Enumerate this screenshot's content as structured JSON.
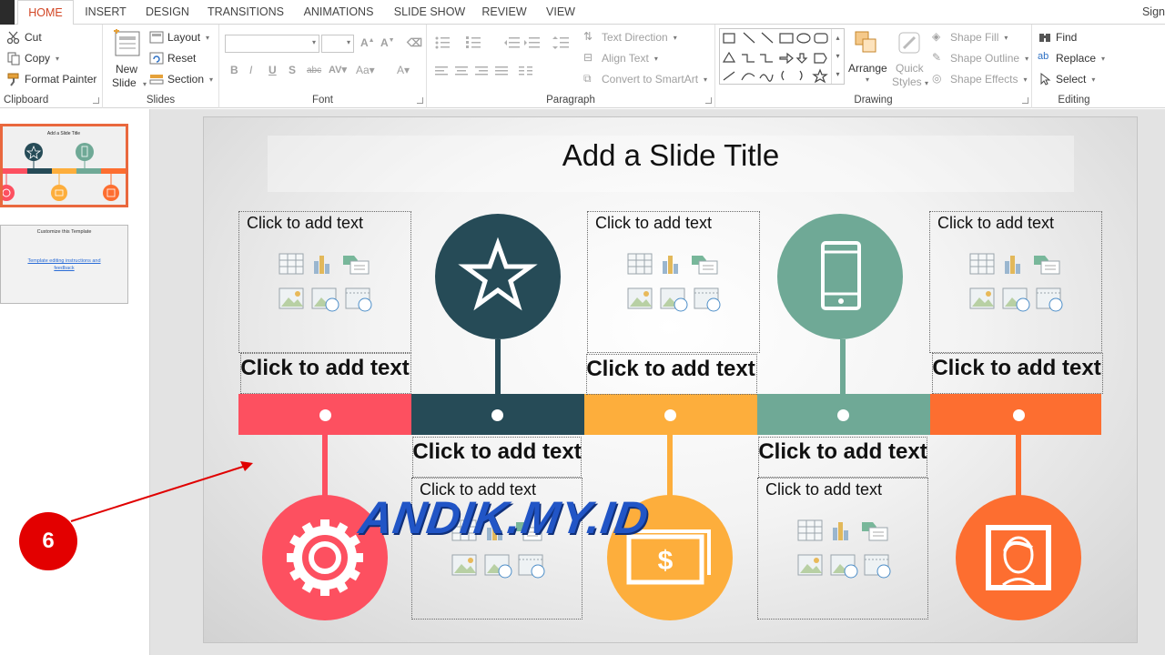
{
  "tabs": [
    "HOME",
    "INSERT",
    "DESIGN",
    "TRANSITIONS",
    "ANIMATIONS",
    "SLIDE SHOW",
    "REVIEW",
    "VIEW"
  ],
  "active_tab": "HOME",
  "sign_in": "Sign",
  "clipboard": {
    "cut": "Cut",
    "copy": "Copy",
    "format_painter": "Format Painter",
    "label": "Clipboard"
  },
  "slides_group": {
    "new_slide_1": "New",
    "new_slide_2": "Slide",
    "layout": "Layout",
    "reset": "Reset",
    "section": "Section",
    "label": "Slides"
  },
  "font_group": {
    "label": "Font"
  },
  "paragraph_group": {
    "text_direction": "Text Direction",
    "align_text": "Align Text",
    "convert_smartart": "Convert to SmartArt",
    "label": "Paragraph"
  },
  "drawing_group": {
    "arrange": "Arrange",
    "quick_styles_1": "Quick",
    "quick_styles_2": "Styles",
    "shape_fill": "Shape Fill",
    "shape_outline": "Shape Outline",
    "shape_effects": "Shape Effects",
    "label": "Drawing"
  },
  "editing_group": {
    "find": "Find",
    "replace": "Replace",
    "select": "Select",
    "label": "Editing"
  },
  "thumbnails": [
    {
      "title": "Add a Slide Title"
    },
    {
      "title": "Customize this Template",
      "link": "Template editing instructions and feedback"
    }
  ],
  "slide": {
    "title": "Add a Slide Title",
    "placeholder_small": "Click to add text",
    "placeholder_big": "Click to add text",
    "colors": {
      "red": "#fd5060",
      "navy": "#264b57",
      "yellow": "#fdae3c",
      "sage": "#6fa996",
      "orange": "#fd6e30"
    }
  },
  "watermark": "ANDIK.MY.ID",
  "step_badge": "6",
  "icons": [
    "cut-icon",
    "copy-icon",
    "format-painter-icon",
    "new-slide-icon",
    "layout-icon",
    "reset-icon",
    "section-icon",
    "find-icon",
    "replace-icon",
    "select-icon",
    "star-icon",
    "phone-icon",
    "gear-icon",
    "money-icon",
    "person-icon"
  ]
}
